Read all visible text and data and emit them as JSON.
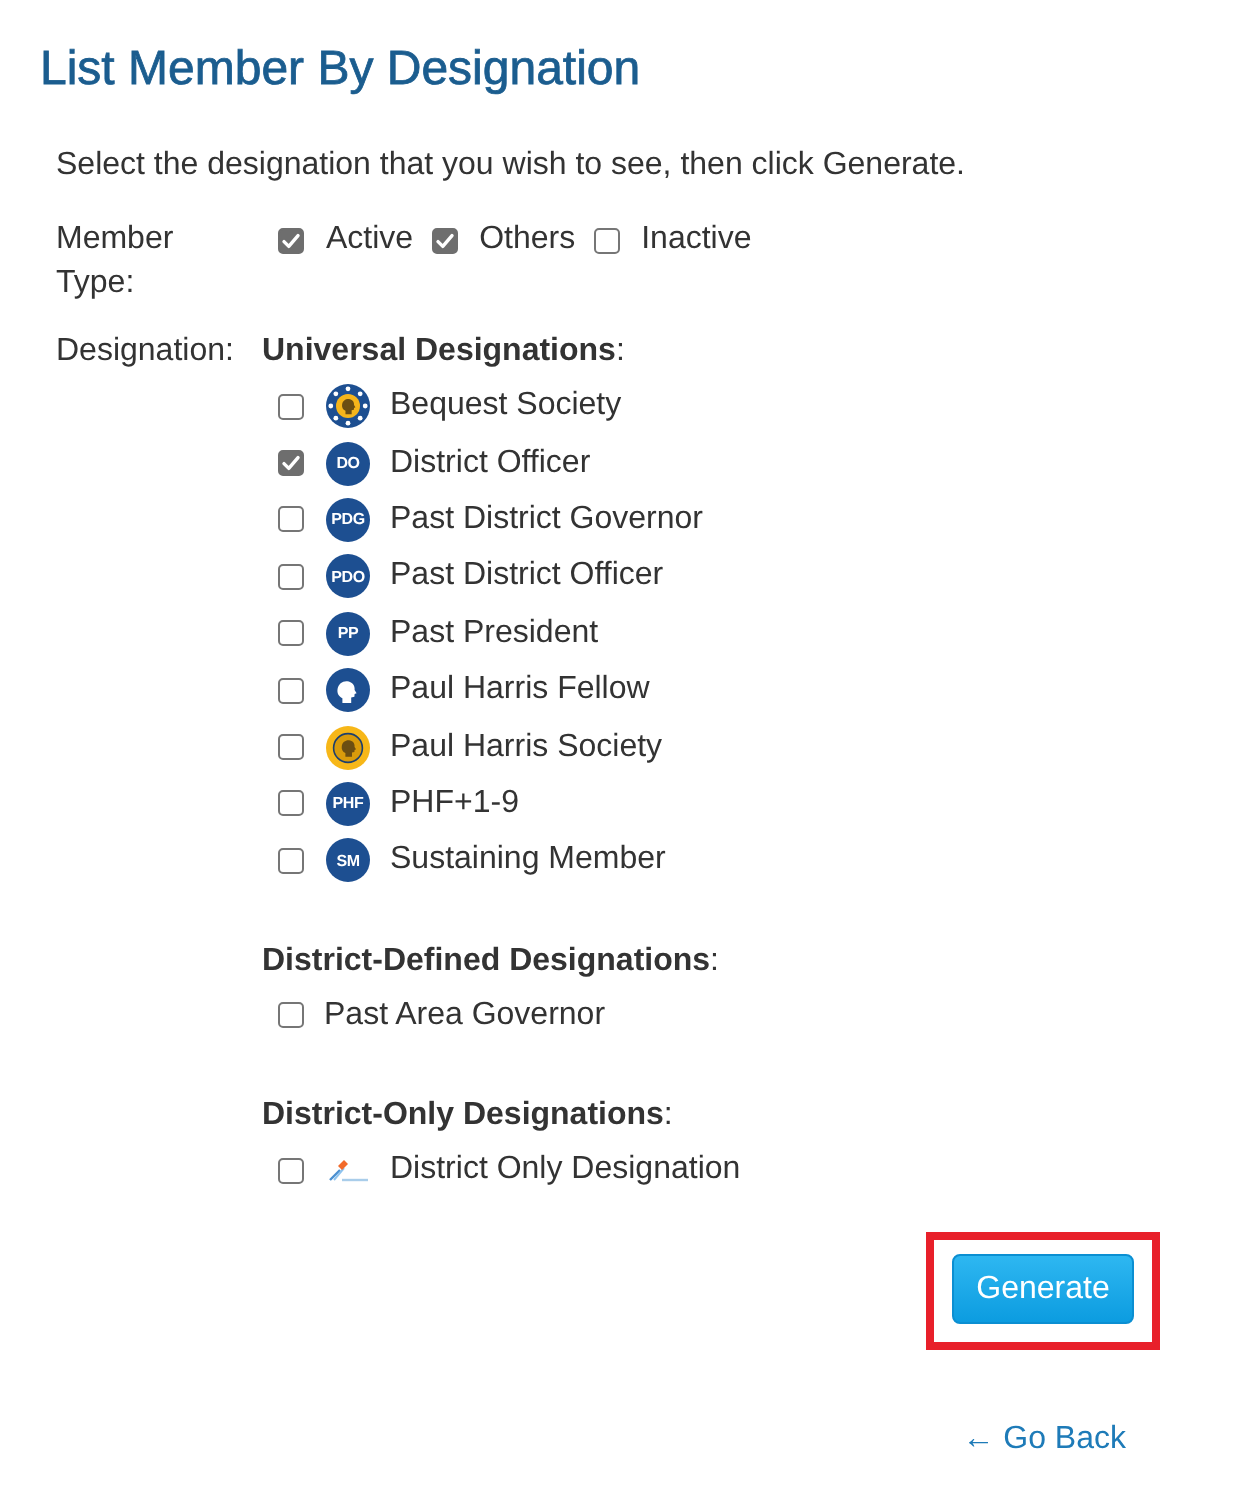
{
  "title": "List Member By Designation",
  "instructions": "Select the designation that you wish to see, then click Generate.",
  "member_type": {
    "label": "Member Type:",
    "options": [
      {
        "label": "Active",
        "checked": true
      },
      {
        "label": "Others",
        "checked": true
      },
      {
        "label": "Inactive",
        "checked": false
      }
    ]
  },
  "designation": {
    "label": "Designation:",
    "groups": [
      {
        "heading": "**Universal Designations**:",
        "items": [
          {
            "label": "Bequest Society",
            "checked": false,
            "icon": {
              "kind": "medallion"
            }
          },
          {
            "label": "District Officer",
            "checked": true,
            "icon": {
              "kind": "badge",
              "text": "DO"
            }
          },
          {
            "label": "Past District Governor",
            "checked": false,
            "icon": {
              "kind": "badge",
              "text": "PDG"
            }
          },
          {
            "label": "Past District Officer",
            "checked": false,
            "icon": {
              "kind": "badge",
              "text": "PDO"
            }
          },
          {
            "label": "Past President",
            "checked": false,
            "icon": {
              "kind": "badge",
              "text": "PP"
            }
          },
          {
            "label": "Paul Harris Fellow",
            "checked": false,
            "icon": {
              "kind": "silhouette"
            }
          },
          {
            "label": "Paul Harris Society",
            "checked": false,
            "icon": {
              "kind": "medal"
            }
          },
          {
            "label": "PHF+1-9",
            "checked": false,
            "icon": {
              "kind": "badge",
              "text": "PHF"
            }
          },
          {
            "label": "Sustaining Member",
            "checked": false,
            "icon": {
              "kind": "badge",
              "text": "SM"
            }
          }
        ]
      },
      {
        "heading": "**District-Defined Designations**:",
        "items": [
          {
            "label": "Past Area Governor",
            "checked": false
          }
        ]
      },
      {
        "heading": "**District-Only Designations**:",
        "items": [
          {
            "label": "District Only Designation",
            "checked": false,
            "icon": {
              "kind": "pin"
            }
          }
        ]
      }
    ]
  },
  "generate_button": {
    "label": "Generate",
    "highlighted": true
  },
  "go_back_link": {
    "label": "← Go Back"
  }
}
